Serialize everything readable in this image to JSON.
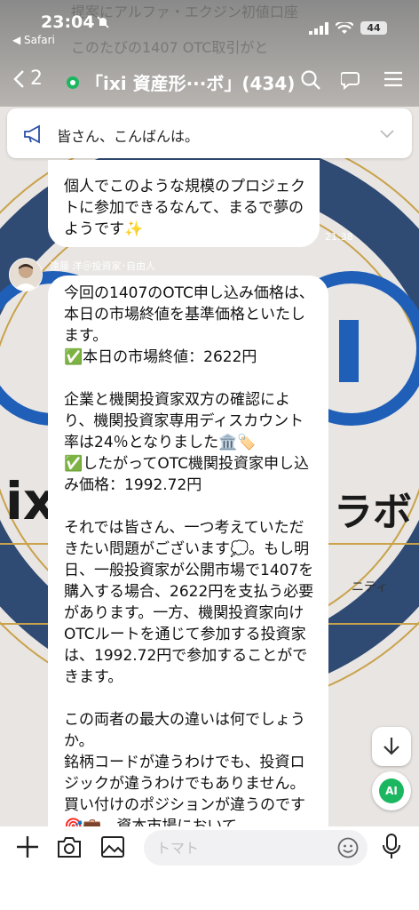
{
  "status_bar": {
    "time": "23:04",
    "back_app": "◀ Safari",
    "battery": "44"
  },
  "nav": {
    "back_count": "2",
    "title": "「ixi 資産形···ボ」(434)"
  },
  "background": {
    "top_text_1": "提案にアルファ・エクジン初値口座",
    "top_text_2": "このたびの1407 OTC取引がと",
    "brand_text": "ixi",
    "brand_text_2": "ラボ",
    "community_text": "ニティ"
  },
  "announcement": {
    "text": "皆さん、こんばんは。"
  },
  "messages": [
    {
      "text": "個人でこのような規模のプロジェクトに参加できるなんて、まるで夢のようです✨",
      "time": "21:38"
    },
    {
      "sender": "遠藤 洋＠投資家･自由人",
      "text": "今回の1407のOTC申し込み価格は、本日の市場終値を基準価格といたします。\n✅本日の市場終値：2622円\n\n企業と機関投資家双方の確認により、機関投資家専用ディスカウント率は24％となりました🏛️🏷️\n✅したがってOTC機関投資家申し込み価格：1992.72円\n\nそれでは皆さん、一つ考えていただきたい問題がございます💭。もし明日、一般投資家が公開市場で1407を購入する場合、2622円を支払う必要があります。一方、機関投資家向けOTCルートを通じて参加する投資家は、1992.72円で参加することができます。\n\nこの両者の最大の違いは何でしょうか。\n銘柄コードが違うわけでも、投資ロジックが違うわけでもありません。買い付けのポジションが違うのです🎯💼。資本市場において"
    }
  ],
  "input": {
    "placeholder": "トマト"
  },
  "ai_label": "AI",
  "colors": {
    "chat_bg_dark": "#2f4a73",
    "line_green": "#1bb760",
    "accent_gold": "#c9a24a"
  }
}
